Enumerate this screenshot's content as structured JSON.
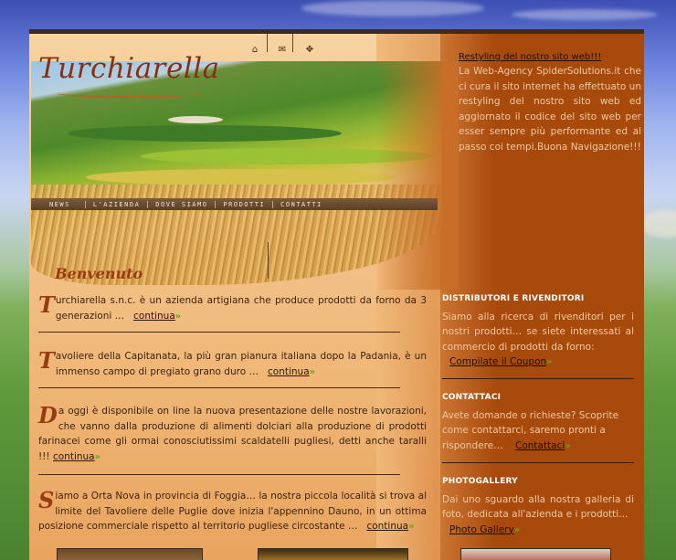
{
  "header": {
    "logo": "Turchiarella",
    "icons": [
      "home-icon",
      "mail-icon",
      "sitemap-icon"
    ]
  },
  "nav": {
    "items": [
      "NEWS",
      "L'AZIENDA",
      "DOVE SIAMO",
      "PRODOTTI",
      "CONTATTI"
    ]
  },
  "main": {
    "heading": "Benvenuto",
    "news": [
      {
        "cap": "T",
        "text": "urchiarella s.n.c. è un azienda artigiana che produce prodotti da forno da 3 generazioni …",
        "more": "continua"
      },
      {
        "cap": "T",
        "text": "avoliere della Capitanata, la più gran pianura italiana dopo la Padania, è un immenso campo di pregiato grano duro …",
        "more": "continua"
      },
      {
        "cap": "D",
        "text": "a oggi è disponibile on line la nuova presentazione delle nostre lavorazioni, che vanno dalla produzione di alimenti dolciari alla produzione di prodotti farinacei come gli ormai conosciutissimi scaldatelli pugliesi, detti anche taralli !!!",
        "more": "continua"
      },
      {
        "cap": "S",
        "text": "iamo a Orta Nova in provincia di Foggia… la nostra piccola località si trova al limite del Tavoliere delle Puglie dove inizia l'appennino Dauno, in un ottima posizione commerciale rispetto al territorio pugliese circostante …",
        "more": "continua"
      }
    ]
  },
  "sidebar": {
    "restyling_title": "Restyling del nostro sito web!!!",
    "restyling_text": "La Web-Agency SpiderSolutions.it che ci cura il sito internet ha effettuato un restyling del nostro sito web ed aggiornato il codice del sito web per esser sempre più performante ed al passo coi tempi.Buona Navigazione!!!",
    "sections": [
      {
        "title": "DISTRIBUTORI E RIVENDITORI",
        "text": "Siamo alla ricerca di rivenditori per i nostri prodotti… se siete interessati al commercio di prodotti da forno:",
        "link": "Compilate il Coupon"
      },
      {
        "title": "CONTATTACI",
        "text": "Avete domande o richieste? Scoprite come contattarci, saremo pronti a rispondere…",
        "link": "Contattaci"
      },
      {
        "title": "PHOTOGALLERY",
        "text": "Dai uno sguardo alla nostra galleria di foto, dedicata all'azienda e i prodotti…",
        "link": "Photo Gallery"
      }
    ]
  },
  "colors": {
    "accent": "#9a3a12",
    "right_bg": "#a94a0d",
    "arrow": "#5ca71f"
  }
}
